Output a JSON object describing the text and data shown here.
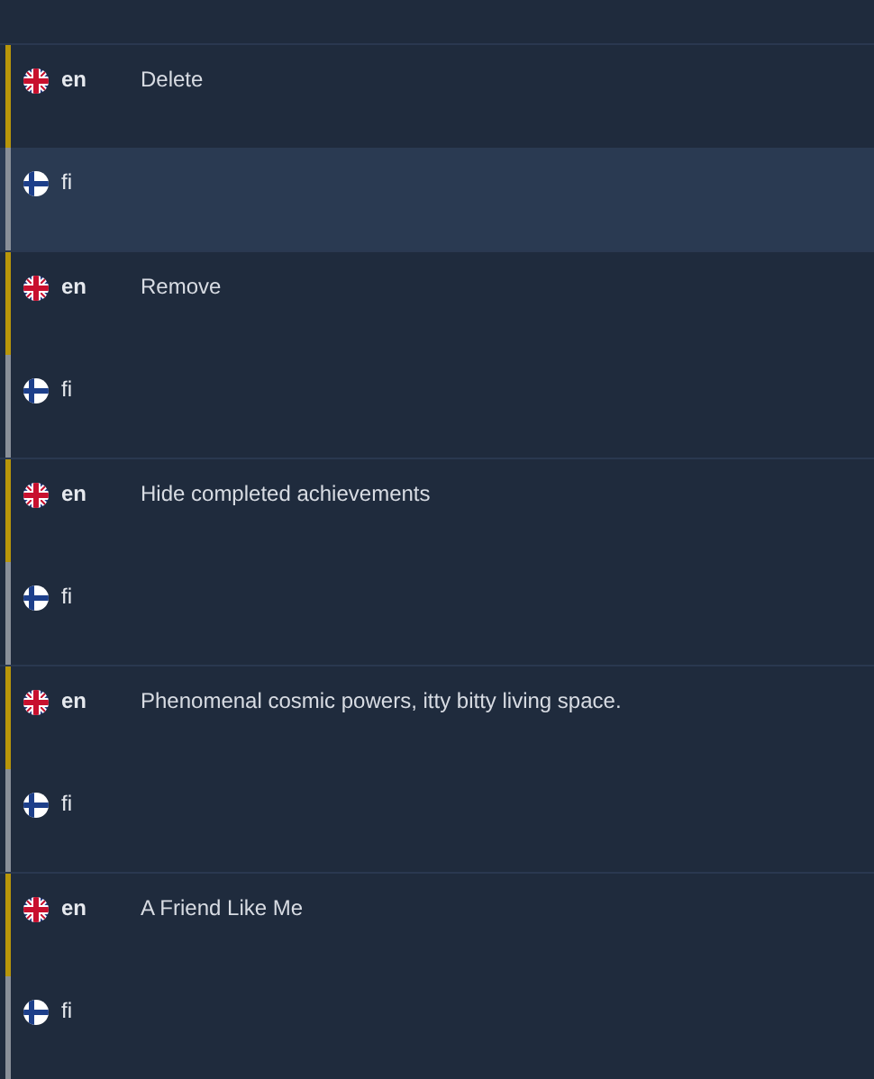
{
  "entries": [
    {
      "rows": [
        {
          "kind": "source",
          "lang": "en",
          "text": "Delete",
          "selected": false
        },
        {
          "kind": "target",
          "lang": "fi",
          "selected": true
        }
      ]
    },
    {
      "rows": [
        {
          "kind": "source",
          "lang": "en",
          "text": "Remove",
          "selected": false
        },
        {
          "kind": "target",
          "lang": "fi",
          "selected": false
        }
      ]
    },
    {
      "rows": [
        {
          "kind": "source",
          "lang": "en",
          "text": "Hide completed achievements",
          "selected": false
        },
        {
          "kind": "target",
          "lang": "fi",
          "selected": false
        }
      ]
    },
    {
      "rows": [
        {
          "kind": "source",
          "lang": "en",
          "text": "Phenomenal cosmic powers, itty bitty living space.",
          "selected": false
        },
        {
          "kind": "target",
          "lang": "fi",
          "selected": false
        }
      ]
    },
    {
      "rows": [
        {
          "kind": "source",
          "lang": "en",
          "text": "A Friend Like Me",
          "selected": false
        },
        {
          "kind": "target",
          "lang": "fi",
          "selected": false
        }
      ]
    }
  ]
}
